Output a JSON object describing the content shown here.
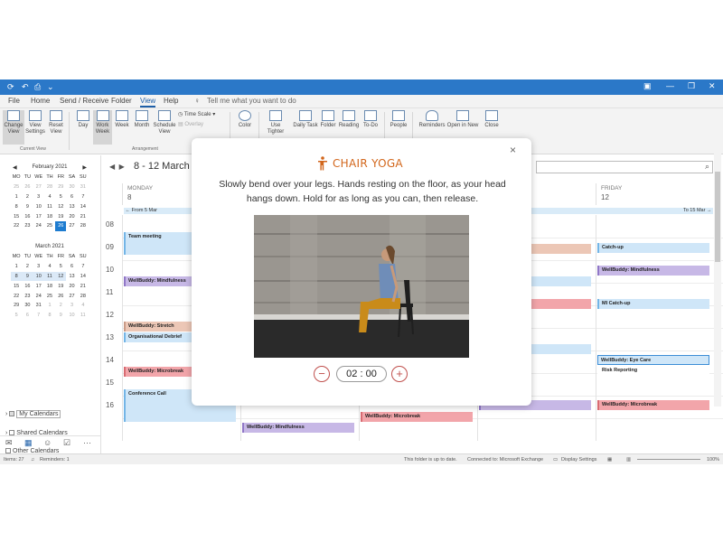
{
  "menu": [
    "File",
    "Home",
    "Send / Receive",
    "Folder",
    "View",
    "Help"
  ],
  "tell_me": "Tell me what you want to do",
  "ribbon": {
    "buttons": [
      {
        "label": "Change View",
        "name": "change-view"
      },
      {
        "label": "View Settings",
        "name": "view-settings"
      },
      {
        "label": "Reset View",
        "name": "reset-view"
      },
      {
        "label": "Day",
        "name": "day"
      },
      {
        "label": "Work Week",
        "name": "work-week"
      },
      {
        "label": "Week",
        "name": "week"
      },
      {
        "label": "Month",
        "name": "month"
      },
      {
        "label": "Schedule View",
        "name": "schedule-view"
      },
      {
        "label": "Color",
        "name": "color"
      },
      {
        "label": "Use Tighter",
        "name": "use-tighter"
      },
      {
        "label": "Daily Task",
        "name": "daily-task"
      },
      {
        "label": "Folder",
        "name": "folder"
      },
      {
        "label": "Reading",
        "name": "reading"
      },
      {
        "label": "To-Do",
        "name": "to-do"
      },
      {
        "label": "People",
        "name": "people"
      },
      {
        "label": "Reminders",
        "name": "reminders"
      },
      {
        "label": "Open in New",
        "name": "open-in-new"
      },
      {
        "label": "Close",
        "name": "close"
      }
    ],
    "time_scale": "Time Scale",
    "overlay": "Overlay",
    "group_current_view": "Current View",
    "group_arrangement": "Arrangement"
  },
  "mini_cal": {
    "feb": {
      "title": "February 2021",
      "days": [
        "MO",
        "TU",
        "WE",
        "TH",
        "FR",
        "SA",
        "SU"
      ],
      "rows": [
        [
          "25",
          "26",
          "27",
          "28",
          "29",
          "30",
          "31"
        ],
        [
          "1",
          "2",
          "3",
          "4",
          "5",
          "6",
          "7"
        ],
        [
          "8",
          "9",
          "10",
          "11",
          "12",
          "13",
          "14"
        ],
        [
          "15",
          "16",
          "17",
          "18",
          "19",
          "20",
          "21"
        ],
        [
          "22",
          "23",
          "24",
          "25",
          "26",
          "27",
          "28"
        ]
      ]
    },
    "mar": {
      "title": "March 2021",
      "days": [
        "MO",
        "TU",
        "WE",
        "TH",
        "FR",
        "SA",
        "SU"
      ],
      "rows": [
        [
          "1",
          "2",
          "3",
          "4",
          "5",
          "6",
          "7"
        ],
        [
          "8",
          "9",
          "10",
          "11",
          "12",
          "13",
          "14"
        ],
        [
          "15",
          "16",
          "17",
          "18",
          "19",
          "20",
          "21"
        ],
        [
          "22",
          "23",
          "24",
          "25",
          "26",
          "27",
          "28"
        ],
        [
          "29",
          "30",
          "31",
          "1",
          "2",
          "3",
          "4"
        ],
        [
          "5",
          "6",
          "7",
          "8",
          "9",
          "10",
          "11"
        ]
      ]
    }
  },
  "calendars": {
    "my": "My Calendars",
    "shared": "Shared Calendars",
    "other": "Other Calendars"
  },
  "header": {
    "date_range": "8 - 12 March 2"
  },
  "days": [
    {
      "name": "MONDAY",
      "date": "8"
    },
    {
      "name": "FRIDAY",
      "date": "12"
    }
  ],
  "allday": {
    "from": "From 5 Mar",
    "to": "To 15 Mar"
  },
  "hours": [
    "08",
    "09",
    "10",
    "11",
    "12",
    "13",
    "14",
    "15",
    "16"
  ],
  "events": {
    "mon": [
      "Team meeting",
      "WellBuddy: Mindfulness",
      "WellBuddy: Stretch",
      "Organisational Debrief",
      "WellBuddy: Microbreak",
      "Conference Call"
    ],
    "tue": [
      "WellBuddy: Mindfulness"
    ],
    "wed": [
      "WellBuddy: Microbreak"
    ],
    "thu": [
      "g",
      "k",
      "ness"
    ],
    "fri": [
      "Catch-up",
      "WellBuddy: Mindfulness",
      "MI Catch-up",
      "WellBuddy: Eye Care",
      "Risk Reporting",
      "WellBuddy: Microbreak"
    ]
  },
  "status": {
    "items": "Items: 27",
    "reminders": "Reminders: 1",
    "uptodate": "This folder is up to date.",
    "connected": "Connected to: Microsoft Exchange",
    "display": "Display Settings",
    "zoom": "100%"
  },
  "modal": {
    "title": "CHAIR YOGA",
    "instruction": "Slowly bend over your legs. Hands resting on the floor, as your head hangs down. Hold for as long as you can, then release.",
    "timer": "02 : 00",
    "minus": "−",
    "plus": "+",
    "close": "×"
  }
}
